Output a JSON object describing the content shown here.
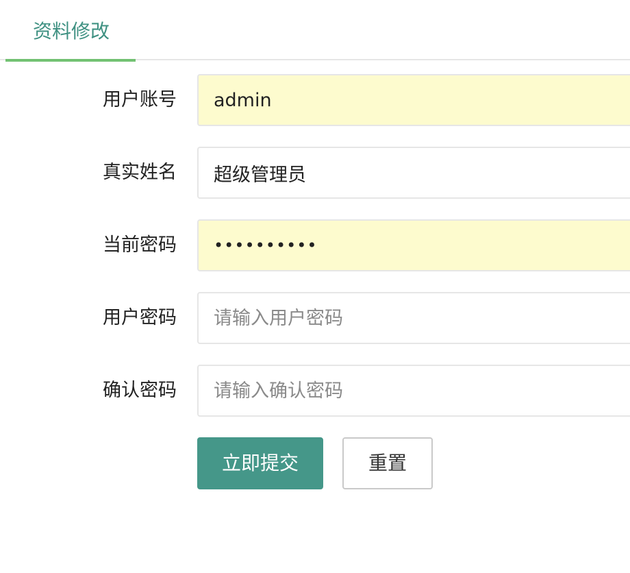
{
  "tabs": [
    {
      "label": "资料修改",
      "active": true
    }
  ],
  "form": {
    "fields": [
      {
        "label": "用户账号",
        "value": "admin",
        "placeholder": "",
        "type": "text",
        "autofill": true
      },
      {
        "label": "真实姓名",
        "value": "超级管理员",
        "placeholder": "",
        "type": "text",
        "autofill": false
      },
      {
        "label": "当前密码",
        "value": "••••••••••",
        "placeholder": "",
        "type": "password",
        "autofill": true
      },
      {
        "label": "用户密码",
        "value": "",
        "placeholder": "请输入用户密码",
        "type": "password",
        "autofill": false
      },
      {
        "label": "确认密码",
        "value": "",
        "placeholder": "请输入确认密码",
        "type": "password",
        "autofill": false
      }
    ],
    "submit_label": "立即提交",
    "reset_label": "重置"
  },
  "colors": {
    "accent": "#459789",
    "tab_text": "#3f9182",
    "tab_underline": "#5cb85c",
    "autofill_bg": "#fdfbce",
    "border": "#e6e6e6"
  }
}
